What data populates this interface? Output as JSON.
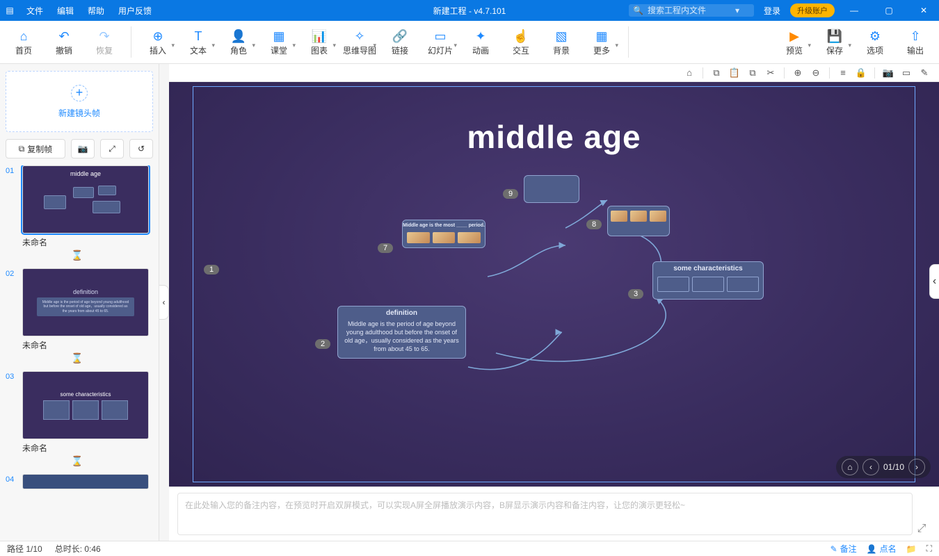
{
  "titlebar": {
    "menus": {
      "file": "文件",
      "edit": "编辑",
      "help": "帮助",
      "feedback": "用户反馈"
    },
    "title": "新建工程 - v4.7.101",
    "search_placeholder": "搜索工程内文件",
    "login": "登录",
    "upgrade": "升级账户"
  },
  "ribbon": {
    "home": "首页",
    "undo": "撤销",
    "redo": "恢复",
    "insert": "插入",
    "text": "文本",
    "role": "角色",
    "class": "课堂",
    "chart": "图表",
    "mindmap": "思维导图",
    "link": "链接",
    "slide": "幻灯片",
    "anim": "动画",
    "interact": "交互",
    "bg": "背景",
    "more": "更多",
    "preview": "预览",
    "save": "保存",
    "options": "选项",
    "export": "输出"
  },
  "side": {
    "newframe": "新建镜头帧",
    "copy": "复制帧",
    "slides": [
      {
        "num": "01",
        "name": "未命名",
        "kind": "overview",
        "title": "middle   age"
      },
      {
        "num": "02",
        "name": "未命名",
        "kind": "def",
        "hdr": "definition",
        "body": "Middle age is the period of age beyond young adulthood but before the onset of old age，usually considered as the years from about 45 to 65."
      },
      {
        "num": "03",
        "name": "未命名",
        "kind": "char",
        "hdr": "some    characteristics"
      },
      {
        "num": "04",
        "name": "",
        "kind": "t4"
      }
    ]
  },
  "canvas": {
    "headline": "middle   age",
    "badges": {
      "b1": "1",
      "b2": "2",
      "b3": "3",
      "b7": "7",
      "b8": "8",
      "b9": "9"
    },
    "card_def": {
      "title": "definition",
      "body": "Middle age is the period of age beyond young adulthood but before the onset of old age，usually considered as the years from about 45 to 65."
    },
    "card_char": {
      "title": "some    characteristics"
    },
    "card7": {
      "title": "Middle age is the most ____ period."
    },
    "pager": "01/10"
  },
  "notes_placeholder": "在此处输入您的备注内容，在预览时开启双屏模式，可以实现A屏全屏播放演示内容，B屏显示演示内容和备注内容，让您的演示更轻松~",
  "status": {
    "path": "路径 1/10",
    "duration": "总时长: 0:46",
    "note": "备注",
    "roll": "点名"
  }
}
